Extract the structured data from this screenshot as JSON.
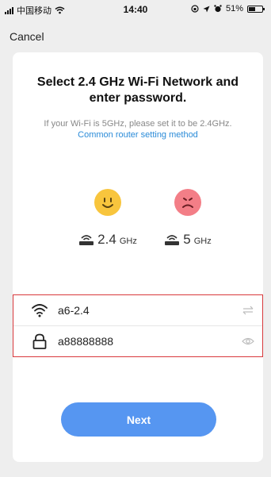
{
  "status_bar": {
    "carrier": "中国移动",
    "time": "14:40",
    "battery": "51%",
    "battery_level": 0.51
  },
  "nav": {
    "cancel_label": "Cancel"
  },
  "content": {
    "title": "Select 2.4 GHz Wi-Fi Network and enter password.",
    "subtitle": "If your Wi-Fi is 5GHz, please set it to be 2.4GHz.",
    "link": "Common router setting method"
  },
  "bands": [
    {
      "value": "2.4",
      "unit": "GHz",
      "face": "happy"
    },
    {
      "value": "5",
      "unit": "GHz",
      "face": "sad"
    }
  ],
  "form": {
    "network_name": "a6-2.4",
    "password": "a88888888"
  },
  "actions": {
    "next_label": "Next"
  },
  "colors": {
    "accent": "#5696f1",
    "link": "#2a8bd8",
    "highlight_border": "#d8393c",
    "happy_face": "#f8c53d",
    "sad_face": "#f37e87"
  }
}
